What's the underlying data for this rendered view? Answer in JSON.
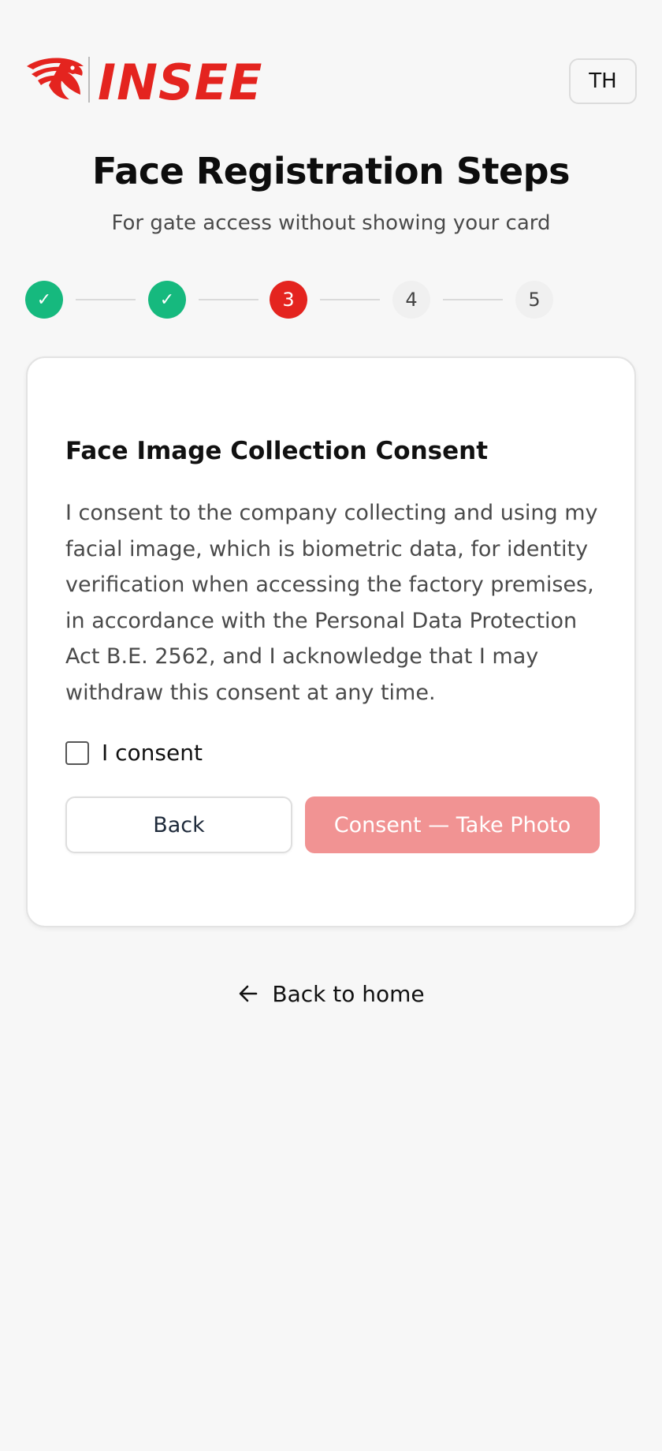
{
  "header": {
    "logo_text": "INSEE",
    "language_label": "TH"
  },
  "page": {
    "title": "Face Registration Steps",
    "subtitle": "For gate access without showing your card"
  },
  "stepper": {
    "current_step": 3,
    "steps": [
      {
        "label": "✓",
        "status": "done"
      },
      {
        "label": "✓",
        "status": "done"
      },
      {
        "label": "3",
        "status": "active"
      },
      {
        "label": "4",
        "status": "pending"
      },
      {
        "label": "5",
        "status": "pending"
      }
    ]
  },
  "card": {
    "title": "Face Image Collection Consent",
    "body": "I consent to the company collecting and using my facial image, which is biometric data, for identity verification when accessing the factory premises, in accordance with the Personal Data Protection Act B.E. 2562, and I acknowledge that I may withdraw this consent at any time.",
    "checkbox_label": "I consent",
    "checkbox_checked": false,
    "back_label": "Back",
    "consent_label": "Consent — Take Photo"
  },
  "footer": {
    "home_link_label": "Back to home"
  },
  "colors": {
    "brand_red": "#e4241f",
    "step_done_green": "#16b97e",
    "consent_button_disabled": "#f19393",
    "background": "#f7f7f7"
  },
  "icons": {
    "logo": "eagle-logo",
    "done_step": "check-icon",
    "home_link": "arrow-left-icon"
  }
}
